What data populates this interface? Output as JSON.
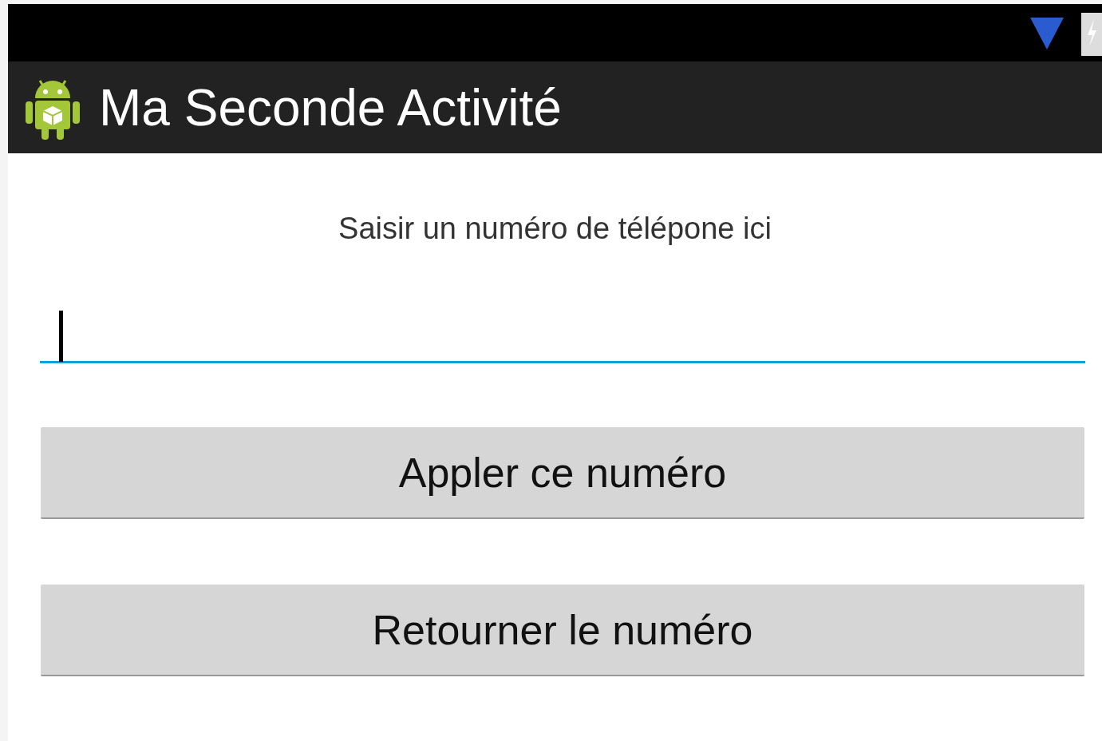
{
  "action_bar": {
    "title": "Ma Seconde Activité"
  },
  "content": {
    "label": "Saisir un numéro de télépone ici",
    "field": {
      "focused": true
    },
    "buttons": [
      "Appler ce numéro",
      "Retourner le numéro"
    ]
  }
}
